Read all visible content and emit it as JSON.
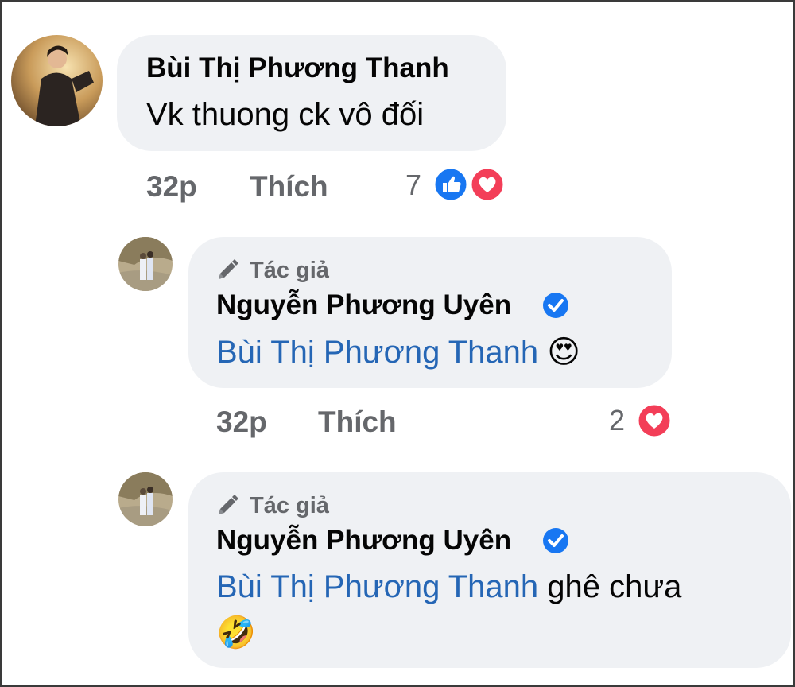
{
  "comments": [
    {
      "author": "Bùi Thị Phương Thanh",
      "text": "Vk thuong ck vô đối",
      "time": "32p",
      "like_label": "Thích",
      "reaction_count": "7"
    }
  ],
  "replies": [
    {
      "role_label": "Tác giả",
      "author": "Nguyễn Phương Uyên",
      "mention": "Bùi Thị Phương Thanh",
      "text": "",
      "emoji": "😍",
      "time": "32p",
      "like_label": "Thích",
      "reaction_count": "2"
    },
    {
      "role_label": "Tác giả",
      "author": "Nguyễn Phương Uyên",
      "mention": "Bùi Thị Phương Thanh",
      "text": "ghê chưa",
      "emoji": "🤣"
    }
  ],
  "colors": {
    "bubble": "#eff1f4",
    "mention": "#2566b5",
    "meta": "#65676b",
    "like": "#1877f2",
    "love": "#f33e58"
  },
  "icons": [
    "like-reaction-icon",
    "love-reaction-icon",
    "pencil-icon",
    "verified-badge-icon"
  ]
}
